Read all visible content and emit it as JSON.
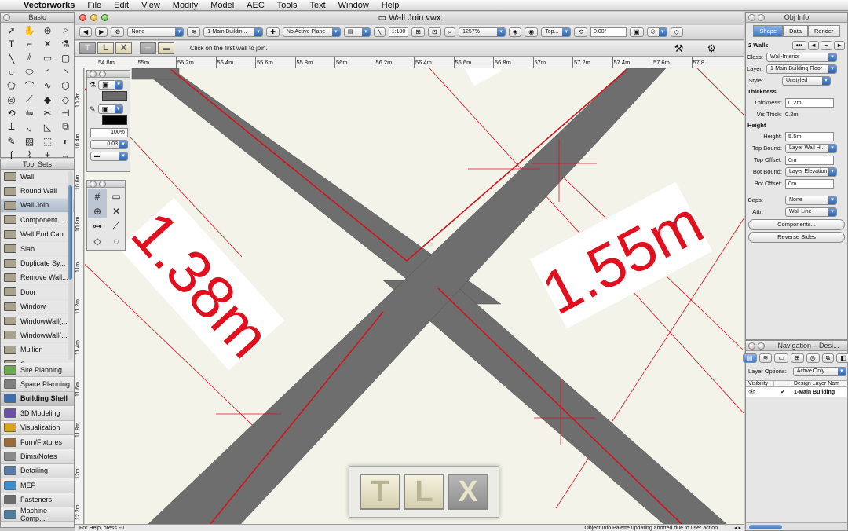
{
  "menubar": {
    "app": "Vectorworks",
    "items": [
      "File",
      "Edit",
      "View",
      "Modify",
      "Model",
      "AEC",
      "Tools",
      "Text",
      "Window",
      "Help"
    ]
  },
  "basic_palette": {
    "title": "Basic",
    "tools": [
      "selection-icon",
      "pan-icon",
      "flyover-icon",
      "zoom-icon",
      "text-icon",
      "callout-icon",
      "x-icon",
      "attribute-icon",
      "line-icon",
      "double-line-icon",
      "rectangle-icon",
      "rounded-rect-icon",
      "circle-icon",
      "oval-icon",
      "arc-icon",
      "quarter-arc-icon",
      "polygon-icon",
      "polyline-icon",
      "freehand-icon",
      "regular-polygon-icon",
      "spiral-icon",
      "eyedropper-icon",
      "paint-icon",
      "reshape-icon",
      "rotate-icon",
      "mirror-icon",
      "split-icon",
      "connect-icon",
      "trim-icon",
      "fillet-icon",
      "chamfer-icon",
      "offset-icon",
      "pencil-icon",
      "hatch-icon",
      "3d-icon",
      "visibility-icon",
      "bezier-icon",
      "cubic-icon",
      "loci-icon",
      "dimension-icon"
    ]
  },
  "tool_sets": {
    "title": "Tool Sets",
    "tools": [
      {
        "label": "Wall",
        "selected": false
      },
      {
        "label": "Round Wall",
        "selected": false
      },
      {
        "label": "Wall Join",
        "selected": true
      },
      {
        "label": "Component ...",
        "selected": false
      },
      {
        "label": "Wall End Cap",
        "selected": false
      },
      {
        "label": "Slab",
        "selected": false
      },
      {
        "label": "Duplicate Sy...",
        "selected": false
      },
      {
        "label": "Remove Wall...",
        "selected": false
      },
      {
        "label": "Door",
        "selected": false
      },
      {
        "label": "Window",
        "selected": false
      },
      {
        "label": "WindowWall(...",
        "selected": false
      },
      {
        "label": "WindowWall(...",
        "selected": false
      },
      {
        "label": "Mullion",
        "selected": false
      },
      {
        "label": "Space",
        "selected": false
      }
    ],
    "sets": [
      {
        "label": "Site Planning",
        "color": "#6aa84f",
        "selected": false
      },
      {
        "label": "Space Planning",
        "color": "#7f7f7f",
        "selected": false
      },
      {
        "label": "Building Shell",
        "color": "#3d6fb0",
        "selected": true
      },
      {
        "label": "3D Modeling",
        "color": "#6b4fa8",
        "selected": false
      },
      {
        "label": "Visualization",
        "color": "#d9a521",
        "selected": false
      },
      {
        "label": "Furn/Fixtures",
        "color": "#9b6b3a",
        "selected": false
      },
      {
        "label": "Dims/Notes",
        "color": "#8a8a8a",
        "selected": false
      },
      {
        "label": "Detailing",
        "color": "#5a7da8",
        "selected": false
      },
      {
        "label": "MEP",
        "color": "#3c8ecf",
        "selected": false
      },
      {
        "label": "Fasteners",
        "color": "#6d6d6d",
        "selected": false
      },
      {
        "label": "Machine Comp...",
        "color": "#4f7f9f",
        "selected": false
      }
    ]
  },
  "document": {
    "title": "Wall Join.vwx"
  },
  "view_bar": {
    "class": "None",
    "layer": "1-Main Buildin...",
    "plane": "No Active Plane",
    "scale": "1:100",
    "zoom": "1257%",
    "view": "Top...",
    "rotation": "0.00°"
  },
  "mode_bar": {
    "modes": [
      "T",
      "L",
      "X"
    ],
    "active_mode": "T",
    "prompt": "Click on the first wall to join."
  },
  "rulers": {
    "top": [
      "54.8m",
      "55m",
      "55.2m",
      "55.4m",
      "55.6m",
      "55.8m",
      "56m",
      "56.2m",
      "56.4m",
      "56.6m",
      "56.8m",
      "57m",
      "57.2m",
      "57.4m",
      "57.6m",
      "57.8"
    ],
    "left": [
      "10.2m",
      "10.4m",
      "10.6m",
      "10.8m",
      "11m",
      "11.2m",
      "11.4m",
      "11.6m",
      "11.8m",
      "12m",
      "12.2m"
    ]
  },
  "canvas": {
    "dim_left": "1.38m",
    "dim_right": "1.55m",
    "wall_color": "#6e6e6e",
    "edge_color": "#d0141e",
    "dim_color": "#e0101e"
  },
  "attribute_palette": {
    "opacity": "100%",
    "line_weight": "0.03"
  },
  "status_bar": {
    "help": "For Help, press F1",
    "message": "Object Info Palette updating aborted due to user action"
  },
  "obj_info": {
    "title": "Obj Info",
    "tabs": [
      "Shape",
      "Data",
      "Render"
    ],
    "active_tab": "Shape",
    "selection": "2 Walls",
    "class": "Wall-Interior",
    "layer": "1-Main Building Floor",
    "style": "Unstyled",
    "thickness_section": "Thickness",
    "thickness_label": "Thickness:",
    "thickness": "0.2m",
    "vis_thick_label": "Vis Thick:",
    "vis_thick": "0.2m",
    "height_section": "Height",
    "height_label": "Height:",
    "height": "5.5m",
    "top_bound_label": "Top Bound:",
    "top_bound": "Layer Wall H...",
    "top_offset_label": "Top Offset:",
    "top_offset": "0m",
    "bot_bound_label": "Bot Bound:",
    "bot_bound": "Layer Elevation",
    "bot_offset_label": "Bot Offset:",
    "bot_offset": "0m",
    "caps_label": "Caps:",
    "caps": "None",
    "attr_label": "Attr:",
    "attr": "Wall Line",
    "components_button": "Components...",
    "reverse_button": "Reverse Sides",
    "labels": {
      "class": "Class:",
      "layer": "Layer:",
      "style": "Style:"
    }
  },
  "navigation": {
    "title": "Navigation – Desi...",
    "layer_options_label": "Layer Options:",
    "layer_options": "Active Only",
    "col_visibility": "Visibility",
    "col_layer": "Design Layer Nam",
    "rows": [
      {
        "name": "1-Main Building",
        "checked": "✔"
      }
    ]
  },
  "mode_indicator": {
    "buttons": [
      "T",
      "L",
      "X"
    ],
    "active": "X"
  }
}
